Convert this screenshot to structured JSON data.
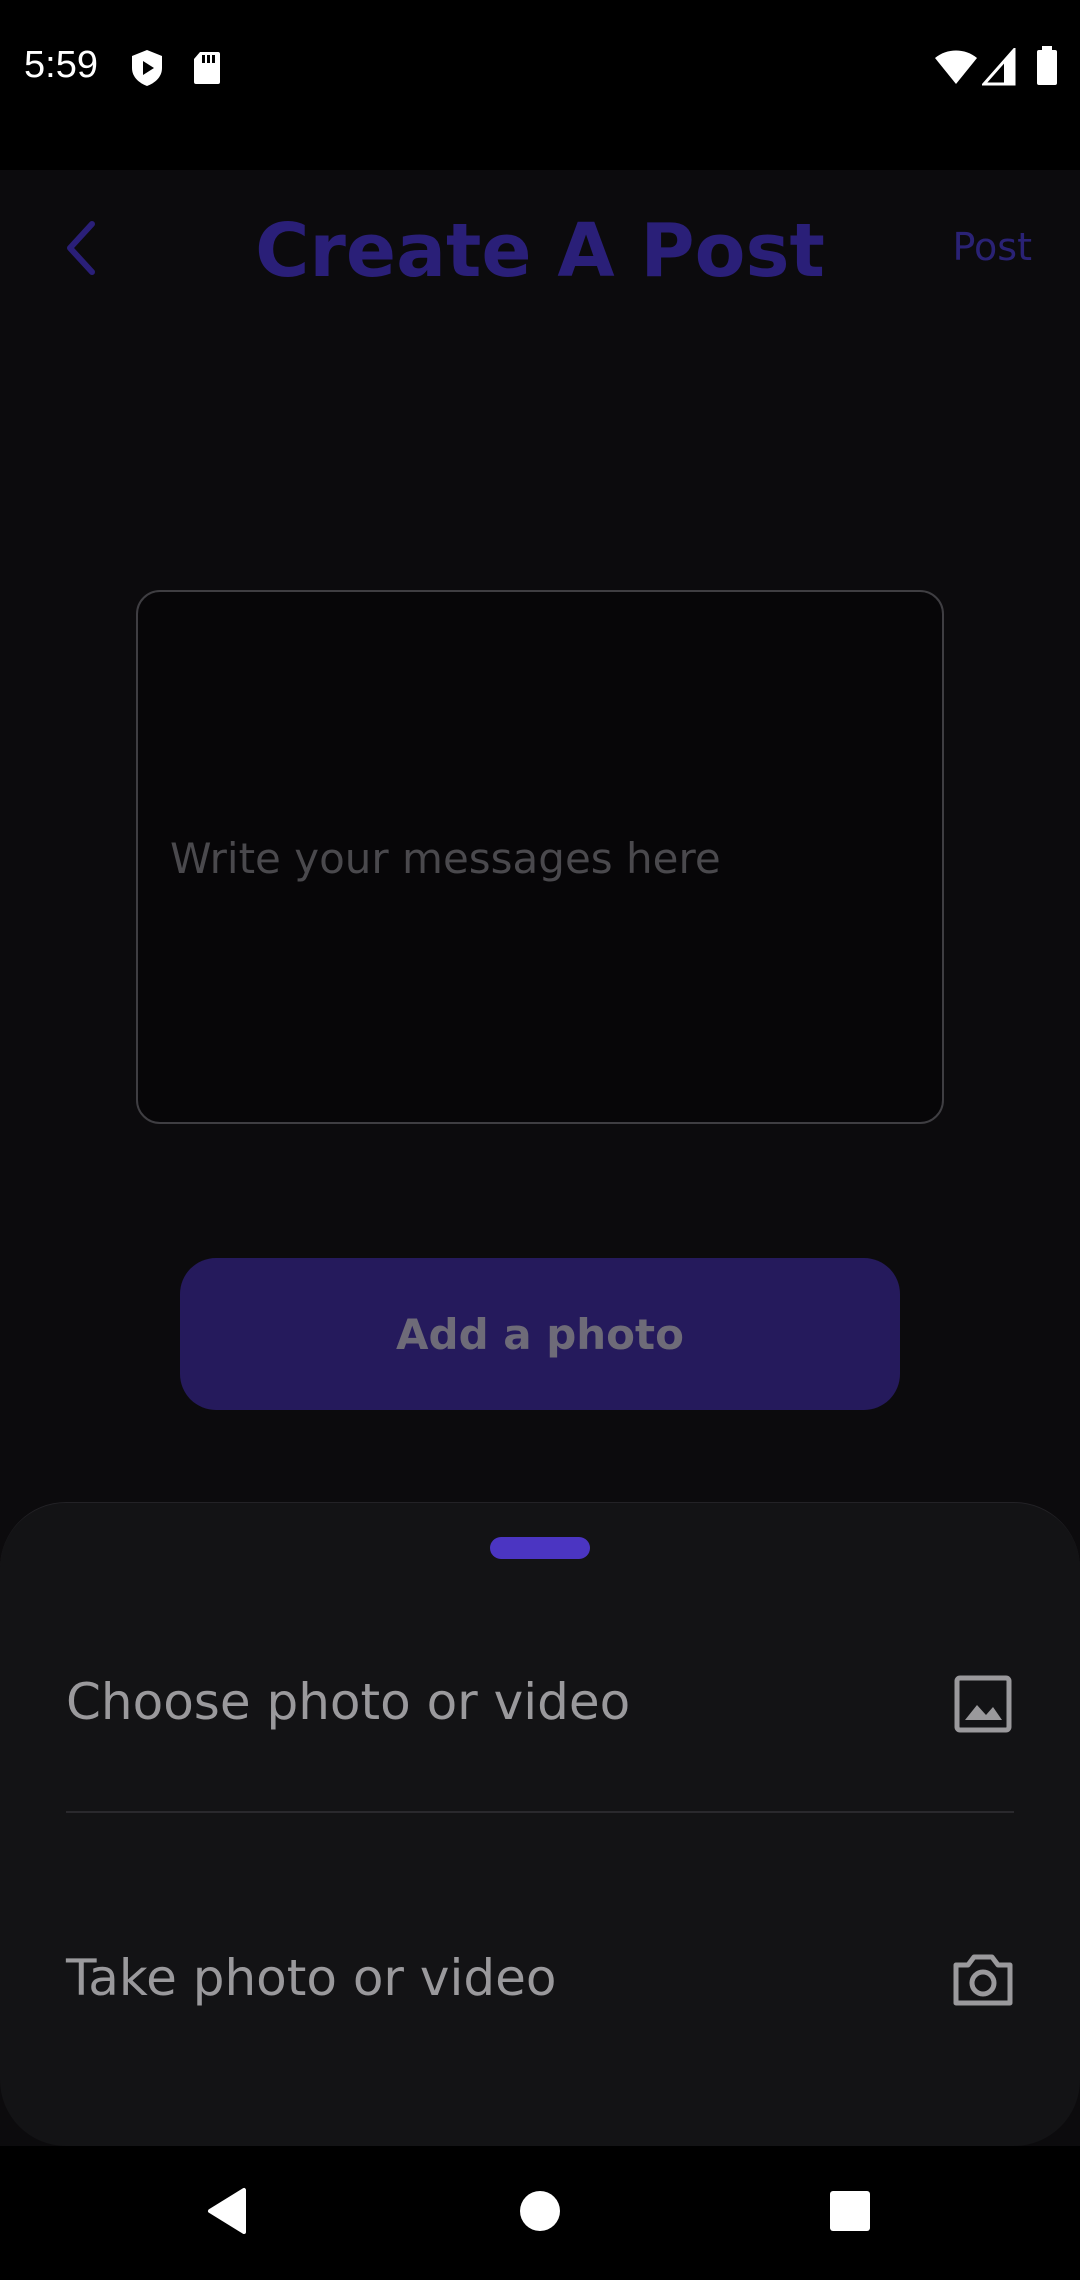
{
  "status_bar": {
    "time": "5:59",
    "left_icons": [
      "shield-play-icon",
      "sd-card-icon"
    ],
    "right_icons": [
      "wifi-icon",
      "signal-icon",
      "battery-icon"
    ]
  },
  "header": {
    "back_icon": "chevron-left-icon",
    "title": "Create A Post",
    "post_label": "Post"
  },
  "composer": {
    "placeholder": "Write your messages here",
    "value": ""
  },
  "add_photo_label": "Add a photo",
  "bottom_sheet": {
    "options": [
      {
        "label": "Choose photo or video",
        "icon": "image-icon"
      },
      {
        "label": "Take photo or video",
        "icon": "camera-icon"
      }
    ]
  },
  "nav_bar": {
    "icons": [
      "back-triangle-icon",
      "home-circle-icon",
      "recents-square-icon"
    ]
  },
  "colors": {
    "accent": "#4b35c2",
    "title": "#2a1f78",
    "button_bg": "#251a5c",
    "sheet_bg": "#131315",
    "background": "#0c0b0d"
  }
}
